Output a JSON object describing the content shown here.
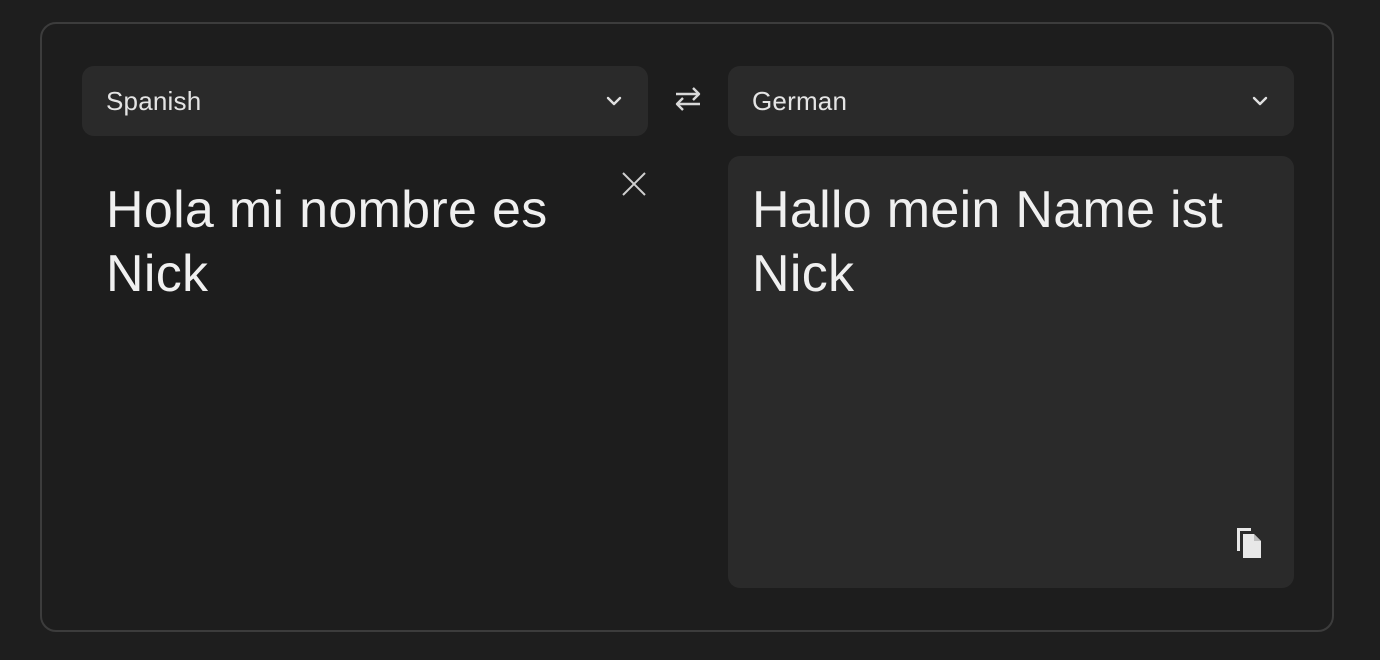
{
  "translator": {
    "source_language": "Spanish",
    "target_language": "German",
    "source_text": "Hola mi nombre es Nick",
    "translated_text": "Hallo mein Name ist Nick"
  },
  "icons": {
    "source_dropdown": "chevron-down-icon",
    "target_dropdown": "chevron-down-icon",
    "swap": "swap-arrows-icon",
    "clear": "close-icon",
    "copy": "copy-icon"
  },
  "colors": {
    "background": "#1e1e1e",
    "panel_border": "#3c3c3c",
    "control_bg": "#2a2a2a",
    "text": "#f0f0f0"
  }
}
